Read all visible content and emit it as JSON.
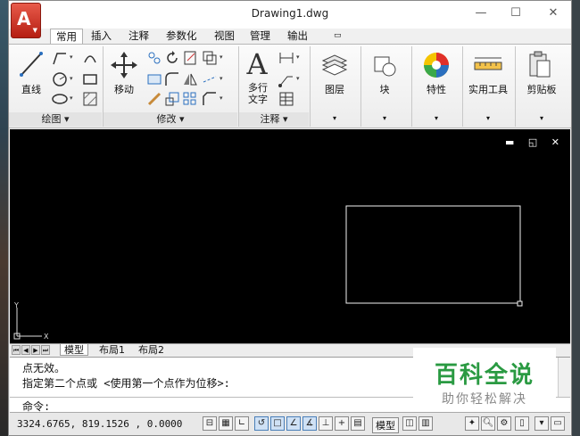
{
  "window": {
    "title": "Drawing1.dwg",
    "minimize": "—",
    "maximize": "☐",
    "close": "✕"
  },
  "ribbon_tabs": [
    "常用",
    "插入",
    "注释",
    "参数化",
    "视图",
    "管理",
    "输出"
  ],
  "ribbon_tab_extra": "▭",
  "panels": {
    "draw": {
      "title": "绘图 ▾",
      "line": "直线"
    },
    "modify": {
      "title": "修改 ▾",
      "move": "移动"
    },
    "annotation": {
      "title": "注释 ▾",
      "mtext_line1": "多行",
      "mtext_line2": "文字"
    },
    "layers": {
      "label": "图层",
      "arrow": "▾"
    },
    "block": {
      "label": "块",
      "arrow": "▾"
    },
    "properties": {
      "label": "特性",
      "arrow": "▾"
    },
    "utilities": {
      "label": "实用工具",
      "arrow": "▾"
    },
    "clipboard": {
      "label": "剪贴板",
      "arrow": "▾"
    }
  },
  "canvas": {
    "controls": "▬ ◱ ✕",
    "ucs_y": "Y",
    "ucs_x": "X"
  },
  "layout_tabs": [
    "模型",
    "布局1",
    "布局2"
  ],
  "command": {
    "history_1": "点无效。",
    "history_2": "指定第二个点或 <使用第一个点作为位移>:",
    "prompt": "命令:"
  },
  "watermark": {
    "title": "百科全说",
    "subtitle": "助你轻松解决"
  },
  "status": {
    "coords": "3324.6765, 819.1526 , 0.0000",
    "model_label": "模型"
  },
  "colors": {
    "accent_red": "#c8281b",
    "canvas_bg": "#000000",
    "watermark_green": "#2a9a42"
  }
}
